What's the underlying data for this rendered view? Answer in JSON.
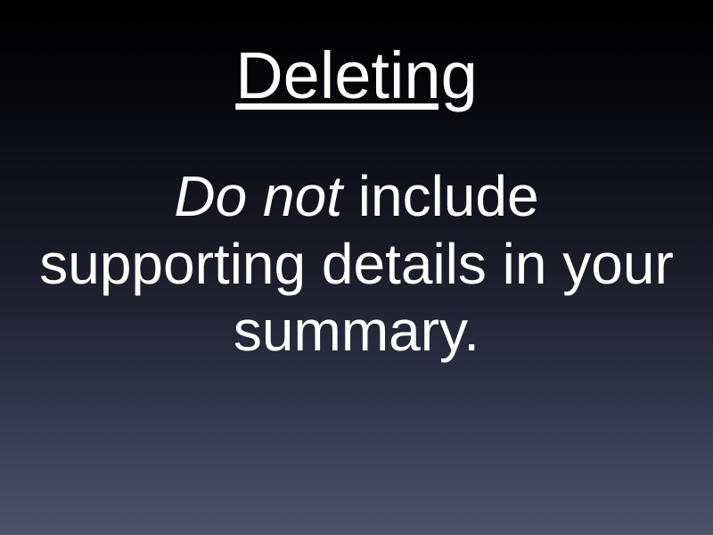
{
  "slide": {
    "title": "Deleting",
    "body_emphasis": "Do not",
    "body_rest": " include supporting details in your summary."
  }
}
